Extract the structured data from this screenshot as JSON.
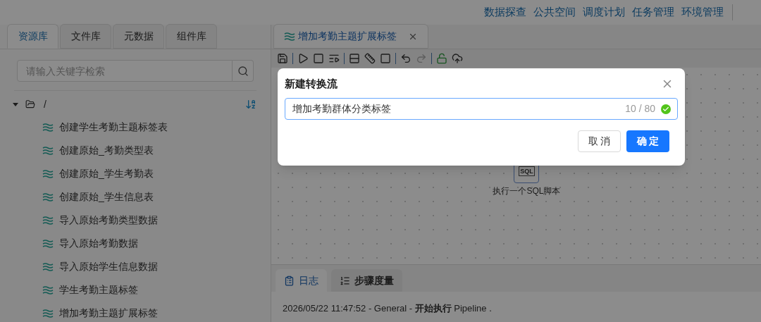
{
  "nav": {
    "links": [
      "数据探查",
      "公共空间",
      "调度计划",
      "任务管理",
      "环境管理"
    ]
  },
  "left_tabs": [
    {
      "label": "资源库",
      "selected": true
    },
    {
      "label": "文件库",
      "selected": false
    },
    {
      "label": "元数据",
      "selected": false
    },
    {
      "label": "组件库",
      "selected": false
    }
  ],
  "search": {
    "placeholder": "请输入关键字检索"
  },
  "tree": {
    "label": "/",
    "expanded": true,
    "children": [
      {
        "label": "创建学生考勤主题标签表"
      },
      {
        "label": "创建原始_考勤类型表"
      },
      {
        "label": "创建原始_学生考勤表"
      },
      {
        "label": "创建原始_学生信息表"
      },
      {
        "label": "导入原始考勤类型数据"
      },
      {
        "label": "导入原始考勤数据"
      },
      {
        "label": "导入原始学生信息数据"
      },
      {
        "label": "学生考勤主题标签"
      },
      {
        "label": "增加考勤主题扩展标签"
      }
    ]
  },
  "editor_tabs": [
    {
      "label": "增加考勤主题扩展标签",
      "selected": true
    }
  ],
  "canvas": {
    "nodes": [
      {
        "label": "执行一个SQL脚本",
        "icon_text": "SQL"
      }
    ]
  },
  "log_panel": {
    "tabs": [
      {
        "label": "日志",
        "selected": true,
        "kind": "log"
      },
      {
        "label": "步骤度量",
        "selected": false,
        "kind": "metrics"
      }
    ],
    "lines": [
      "2026/05/22 11:47:52 - General - **开始执行** Pipeline ."
    ]
  },
  "dialog": {
    "title": "新建转换流",
    "input": {
      "value": "增加考勤群体分类标签",
      "counter": "10 / 80",
      "valid": true
    },
    "buttons": [
      {
        "label": "取 消",
        "kind": "default"
      },
      {
        "label": "确 定",
        "kind": "primary"
      }
    ]
  }
}
